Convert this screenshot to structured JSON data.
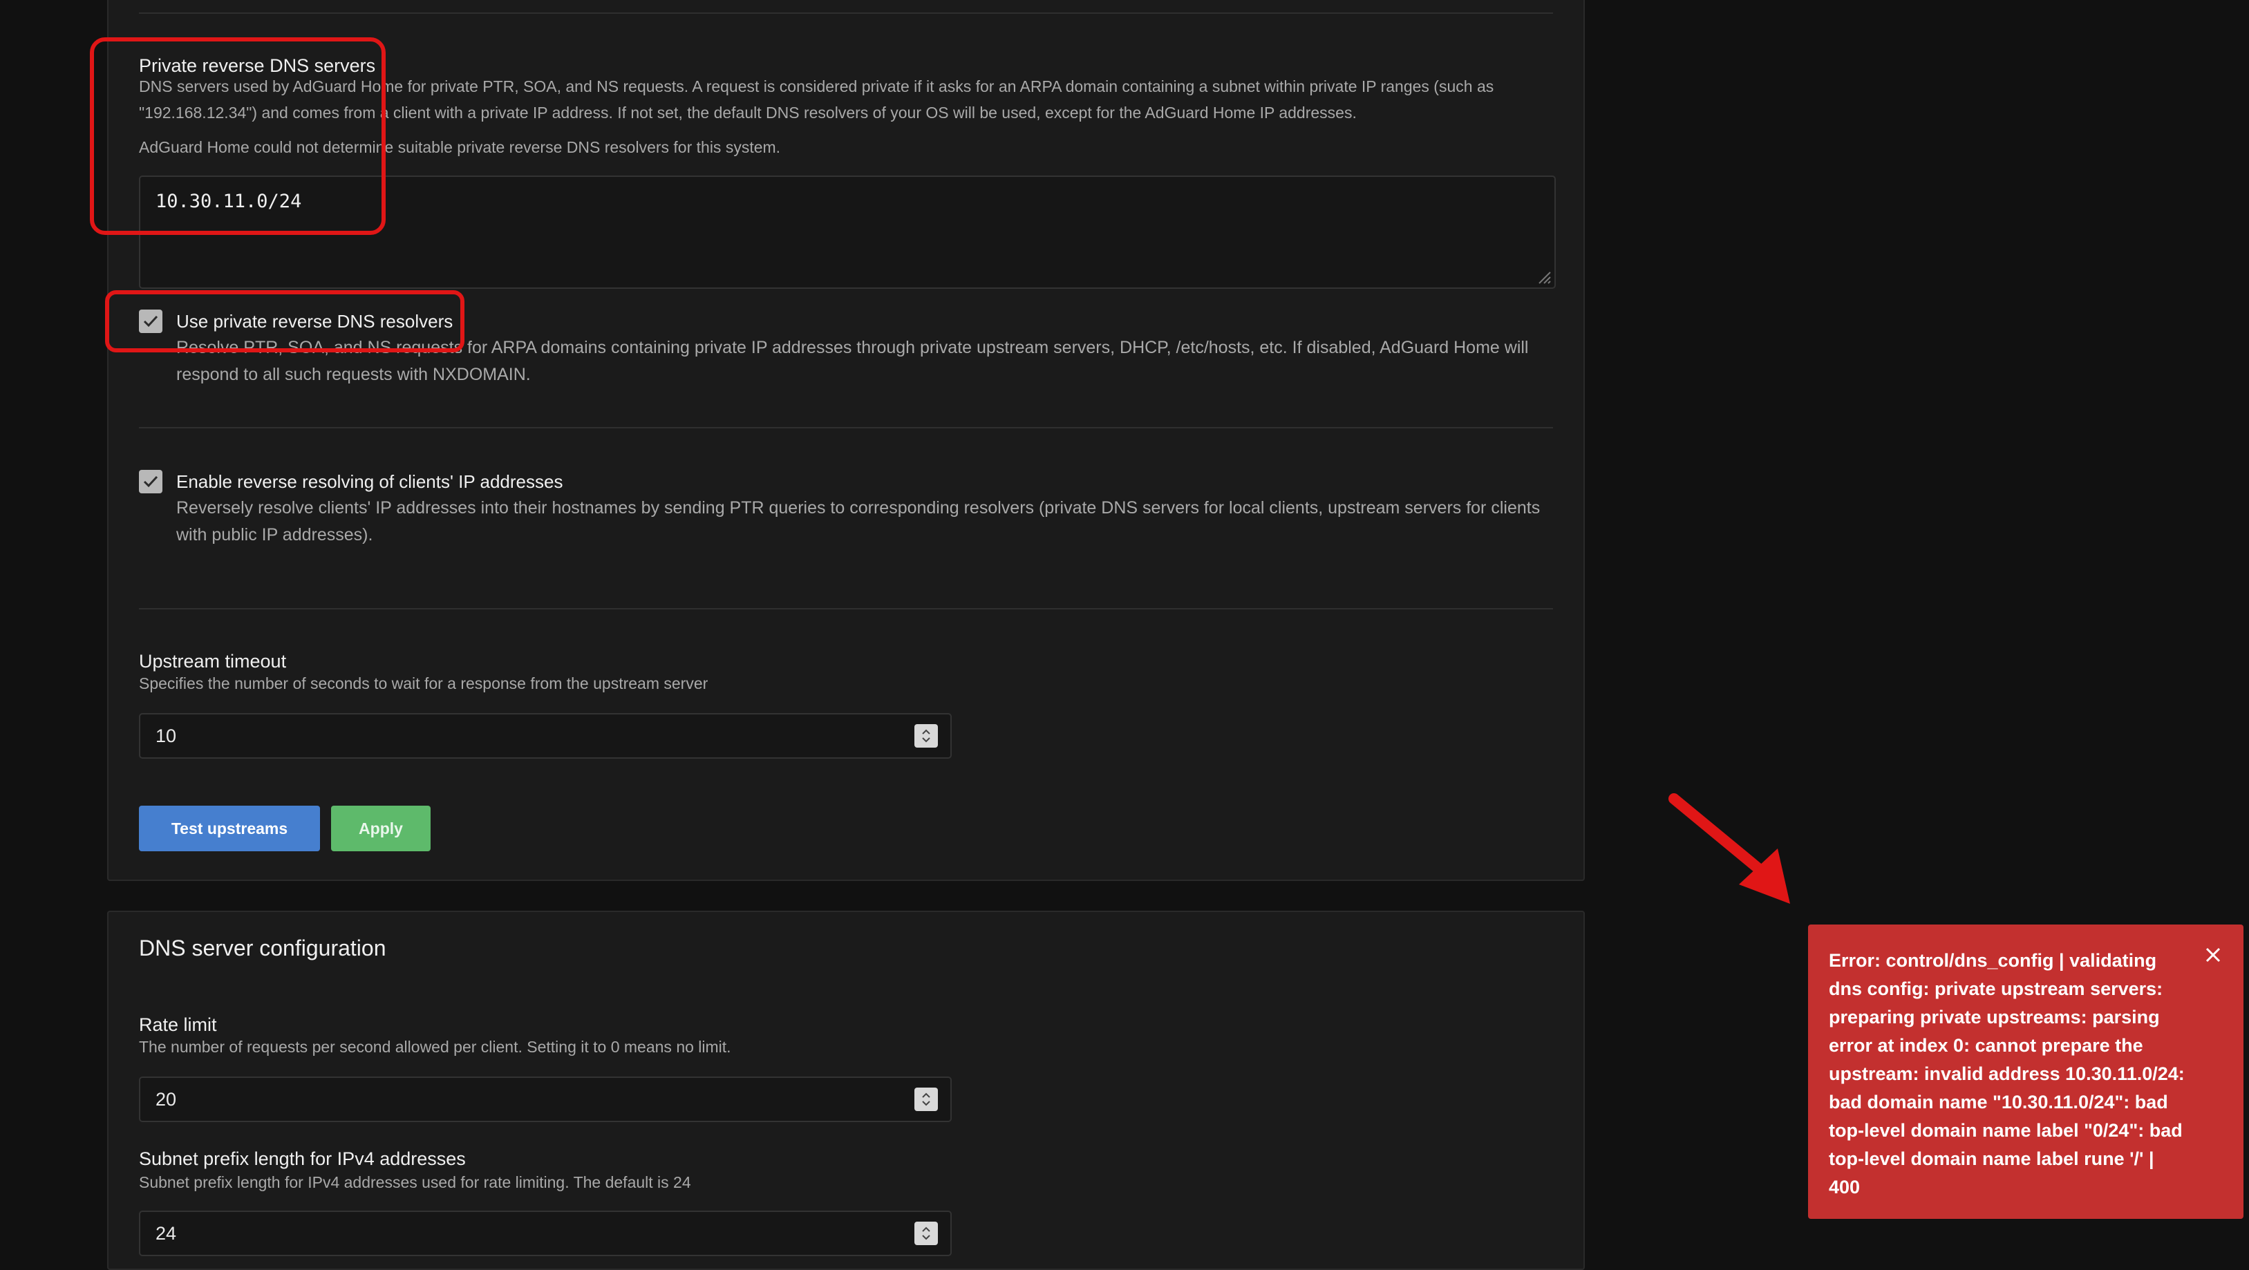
{
  "upstream_section": {
    "private_dns": {
      "title": "Private reverse DNS servers",
      "description": "DNS servers used by AdGuard Home for private PTR, SOA, and NS requests. A request is considered private if it asks for an ARPA domain containing a subnet within private IP ranges (such as \"192.168.12.34\") and comes from a client with a private IP address. If not set, the default DNS resolvers of your OS will be used, except for the AdGuard Home IP addresses.",
      "note": "AdGuard Home could not determine suitable private reverse DNS resolvers for this system.",
      "value": "10.30.11.0/24"
    },
    "use_private_resolvers": {
      "label": "Use private reverse DNS resolvers",
      "description": "Resolve PTR, SOA, and NS requests for ARPA domains containing private IP addresses through private upstream servers, DHCP, /etc/hosts, etc. If disabled, AdGuard Home will respond to all such requests with NXDOMAIN.",
      "checked": true
    },
    "reverse_resolving": {
      "label": "Enable reverse resolving of clients' IP addresses",
      "description": "Reversely resolve clients' IP addresses into their hostnames by sending PTR queries to corresponding resolvers (private DNS servers for local clients, upstream servers for clients with public IP addresses).",
      "checked": true
    },
    "upstream_timeout": {
      "title": "Upstream timeout",
      "description": "Specifies the number of seconds to wait for a response from the upstream server",
      "value": "10"
    },
    "buttons": {
      "test": "Test upstreams",
      "apply": "Apply"
    }
  },
  "dns_server_config": {
    "title": "DNS server configuration",
    "rate_limit": {
      "title": "Rate limit",
      "description": "The number of requests per second allowed per client. Setting it to 0 means no limit.",
      "value": "20"
    },
    "subnet_prefix": {
      "title": "Subnet prefix length for IPv4 addresses",
      "description": "Subnet prefix length for IPv4 addresses used for rate limiting. The default is 24",
      "value": "24"
    }
  },
  "toast": {
    "message": "Error: control/dns_config | validating dns config: private upstream servers: preparing private upstreams: parsing error at index 0: cannot prepare the upstream: invalid address 10.30.11.0/24: bad domain name \"10.30.11.0/24\": bad top-level domain name label \"0/24\": bad top-level domain name label rune '/' | 400",
    "close_icon": "close-icon"
  },
  "annotation": {
    "color": "#e01616"
  }
}
